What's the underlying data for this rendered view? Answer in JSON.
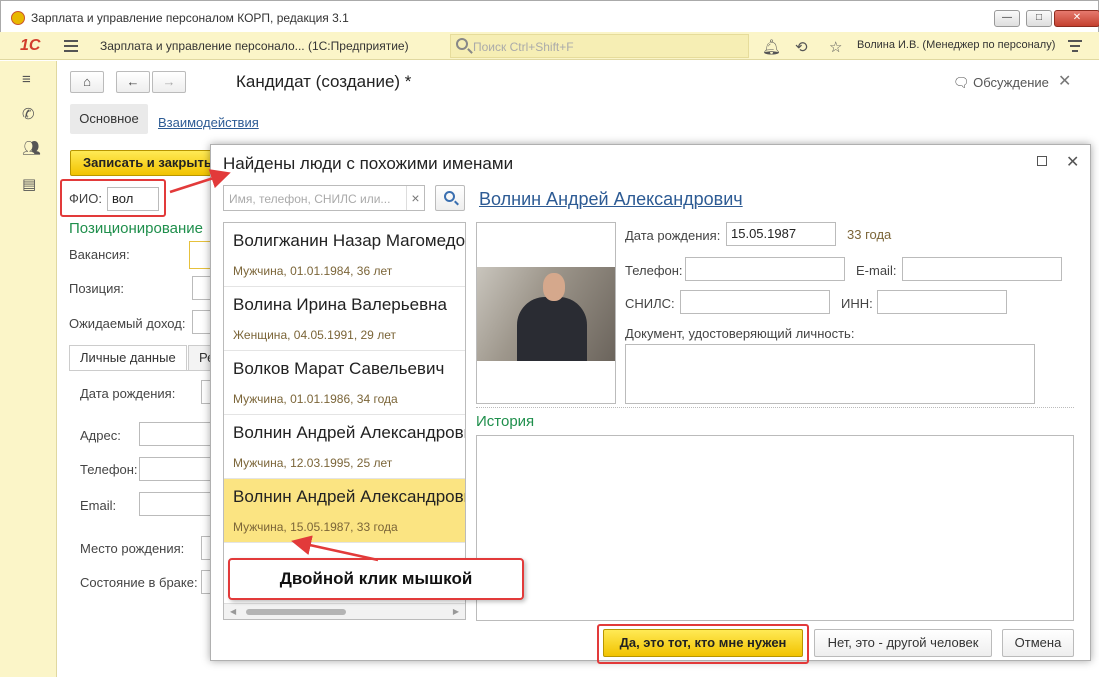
{
  "window": {
    "title": "Зарплата и управление персоналом КОРП, редакция 3.1",
    "min_label": "—",
    "max_label": "□",
    "close_label": "✕"
  },
  "toolbar": {
    "logo": "1С",
    "app_title": "Зарплата и управление персонало... (1С:Предприятие)",
    "search_placeholder": "Поиск Ctrl+Shift+F",
    "user": "Волина И.В. (Менеджер по персоналу)",
    "icons": [
      "menu-icon",
      "bell-icon",
      "history-icon",
      "star-icon",
      "settings-icon"
    ]
  },
  "sidebar": {
    "icons": [
      "menu-icon",
      "phone-icon",
      "people-icon",
      "card-icon"
    ]
  },
  "form": {
    "title": "Кандидат (создание) *",
    "discussion": "Обсуждение",
    "tabs": [
      "Основное",
      "Взаимодействия"
    ],
    "save_close": "Записать и закрыть",
    "fio_label": "ФИО:",
    "fio_value": "вол",
    "positioning": "Позиционирование",
    "vacancy_label": "Вакансия:",
    "position_label": "Позиция:",
    "income_label": "Ожидаемый доход:",
    "subtabs": [
      "Личные данные",
      "Ре"
    ],
    "birth_label": "Дата рождения:",
    "address_label": "Адрес:",
    "phone_label": "Телефон:",
    "email_label": "Email:",
    "birthplace_label": "Место рождения:",
    "marital_label": "Состояние в браке:"
  },
  "dialog": {
    "title": "Найдены люди с похожими именами",
    "search_placeholder": "Имя, телефон, СНИЛС или...",
    "people": [
      {
        "name": "Волигжанин Назар Магомедович",
        "details": "Мужчина, 01.01.1984, 36 лет",
        "selected": false
      },
      {
        "name": "Волина Ирина Валерьевна",
        "details": "Женщина, 04.05.1991, 29 лет",
        "selected": false
      },
      {
        "name": "Волков Марат Савельевич",
        "details": "Мужчина, 01.01.1986, 34 года",
        "selected": false
      },
      {
        "name": "Волнин Андрей Александрович",
        "details": "Мужчина, 12.03.1995, 25 лет",
        "selected": false
      },
      {
        "name": "Волнин Андрей Александрович",
        "details": "Мужчина, 15.05.1987, 33 года",
        "selected": true
      }
    ],
    "person": {
      "name": "Волнин Андрей Александрович",
      "birth_label": "Дата рождения:",
      "birth_value": "15.05.1987",
      "age": "33 года",
      "phone_label": "Телефон:",
      "email_label": "E-mail:",
      "snils_label": "СНИЛС:",
      "inn_label": "ИНН:",
      "document_label": "Документ, удостоверяющий личность:",
      "history_label": "История"
    },
    "buttons": {
      "yes": "Да, это тот, кто мне нужен",
      "no": "Нет, это - другой человек",
      "cancel": "Отмена"
    }
  },
  "annotation": {
    "text": "Двойной клик мышкой",
    "color": "#e23a3a"
  }
}
